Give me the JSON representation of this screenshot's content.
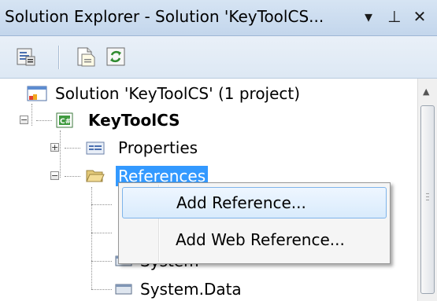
{
  "window": {
    "title": "Solution Explorer - Solution 'KeyToolCS...",
    "dropdown_glyph": "▾",
    "pin_glyph": "⊥",
    "close_glyph": "✕"
  },
  "toolbar": {
    "buttons": [
      {
        "icon": "properties-icon"
      },
      {
        "icon": "show-all-files-icon"
      },
      {
        "icon": "refresh-icon"
      }
    ]
  },
  "tree": {
    "solution": {
      "label": "Solution 'KeyToolCS' (1 project)",
      "icon": "solution-icon"
    },
    "project": {
      "label": "KeyToolCS",
      "icon": "csharp-project-icon",
      "expander": "−"
    },
    "properties": {
      "label": "Properties",
      "icon": "properties-folder-icon",
      "expander": "+"
    },
    "references": {
      "label": "References",
      "icon": "open-folder-icon",
      "expander": "−"
    },
    "ref_items": [
      {
        "label": "System",
        "icon": "assembly-icon"
      },
      {
        "label": "System.Data",
        "icon": "assembly-icon"
      }
    ]
  },
  "context_menu": {
    "items": [
      {
        "label": "Add Reference..."
      },
      {
        "label": "Add Web Reference..."
      }
    ]
  },
  "colors": {
    "selection": "#3399ff",
    "titlebar": "#c3d6ec",
    "menu_highlight_border": "#7eb4ea"
  }
}
